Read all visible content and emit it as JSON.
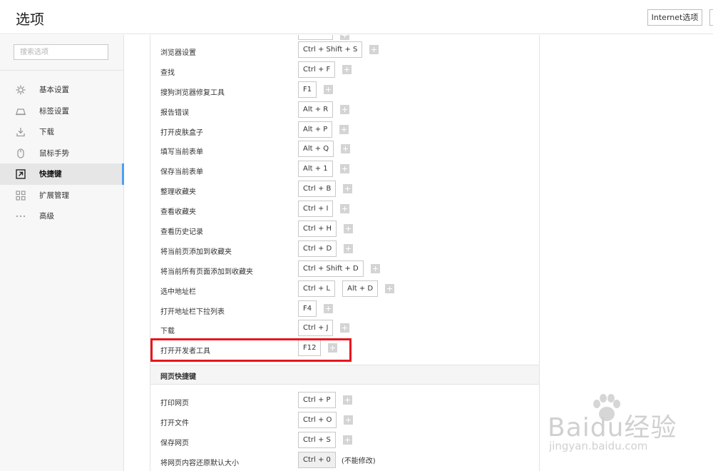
{
  "header": {
    "title": "选项",
    "internet_options_label": "Internet选项"
  },
  "sidebar": {
    "search_placeholder": "搜索选项",
    "items": [
      {
        "label": "基本设置",
        "icon": "gear-icon",
        "active": false
      },
      {
        "label": "标签设置",
        "icon": "tab-icon",
        "active": false
      },
      {
        "label": "下载",
        "icon": "download-icon",
        "active": false
      },
      {
        "label": "鼠标手势",
        "icon": "mouse-icon",
        "active": false
      },
      {
        "label": "快捷键",
        "icon": "shortcut-icon",
        "active": true
      },
      {
        "label": "扩展管理",
        "icon": "extensions-icon",
        "active": false
      },
      {
        "label": "高级",
        "icon": "more-icon",
        "active": false
      }
    ]
  },
  "shortcuts": [
    {
      "label": "浏览器设置",
      "keys": [
        "Ctrl + Shift + S"
      ]
    },
    {
      "label": "查找",
      "keys": [
        "Ctrl + F"
      ]
    },
    {
      "label": "搜狗浏览器修复工具",
      "keys": [
        "F1"
      ]
    },
    {
      "label": "报告错误",
      "keys": [
        "Alt + R"
      ]
    },
    {
      "label": "打开皮肤盒子",
      "keys": [
        "Alt + P"
      ]
    },
    {
      "label": "填写当前表单",
      "keys": [
        "Alt + Q"
      ]
    },
    {
      "label": "保存当前表单",
      "keys": [
        "Alt + 1"
      ]
    },
    {
      "label": "整理收藏夹",
      "keys": [
        "Ctrl + B"
      ]
    },
    {
      "label": "查看收藏夹",
      "keys": [
        "Ctrl + I"
      ]
    },
    {
      "label": "查看历史记录",
      "keys": [
        "Ctrl + H"
      ]
    },
    {
      "label": "将当前页添加到收藏夹",
      "keys": [
        "Ctrl + D"
      ]
    },
    {
      "label": "将当前所有页面添加到收藏夹",
      "keys": [
        "Ctrl + Shift + D"
      ]
    },
    {
      "label": "选中地址栏",
      "keys": [
        "Ctrl + L",
        "Alt + D"
      ]
    },
    {
      "label": "打开地址栏下拉列表",
      "keys": [
        "F4"
      ]
    },
    {
      "label": "下载",
      "keys": [
        "Ctrl + J"
      ]
    },
    {
      "label": "打开开发者工具",
      "keys": [
        "F12"
      ]
    }
  ],
  "web_section": {
    "title": "网页快捷键",
    "shortcuts": [
      {
        "label": "打印网页",
        "keys": [
          "Ctrl + P"
        ],
        "locked": false
      },
      {
        "label": "打开文件",
        "keys": [
          "Ctrl + O"
        ],
        "locked": false
      },
      {
        "label": "保存网页",
        "keys": [
          "Ctrl + S"
        ],
        "locked": false
      },
      {
        "label": "将网页内容还原默认大小",
        "keys": [
          "Ctrl + 0"
        ],
        "locked": true,
        "note": "(不能修改)"
      }
    ]
  },
  "watermark": {
    "main": "Baidu经验",
    "sub": "jingyan.baidu.com"
  },
  "colors": {
    "highlight": "#e8161d",
    "accent": "#4d9ff0"
  }
}
